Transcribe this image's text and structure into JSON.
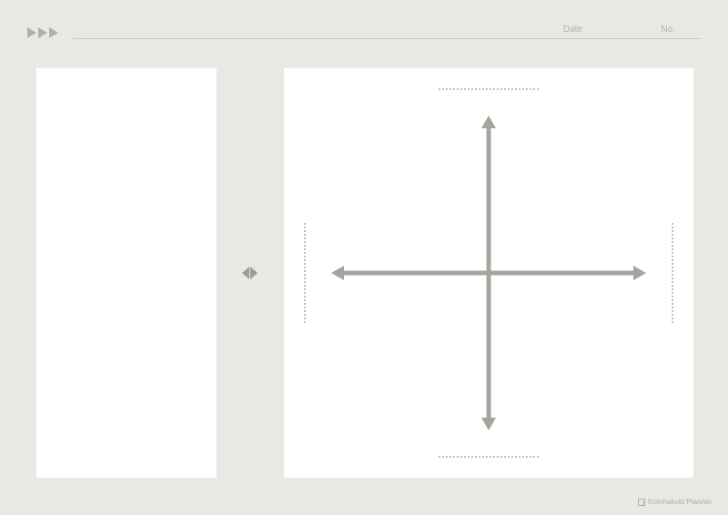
{
  "header": {
    "date_label": "Date",
    "no_label": "No.",
    "date_value": "",
    "no_value": ""
  },
  "axis_labels": {
    "top": "",
    "bottom": "",
    "left": "",
    "right": ""
  },
  "left_panel_content": "",
  "footer": {
    "brand": "Kotohakobi Planner"
  },
  "colors": {
    "page_bg": "#e9e8e5",
    "panel_bg": "#ffffff",
    "axis": "#a7a39d",
    "muted": "#b3afa9"
  }
}
